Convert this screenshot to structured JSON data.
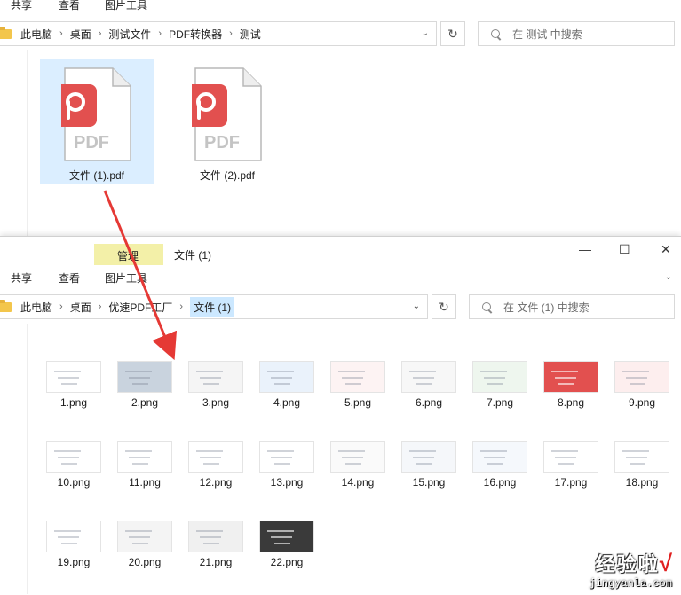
{
  "back_window": {
    "tabs": [
      "共享",
      "查看",
      "图片工具"
    ],
    "breadcrumb": [
      "此电脑",
      "桌面",
      "测试文件",
      "PDF转换器",
      "测试"
    ],
    "search_placeholder": "在 测试 中搜索",
    "files": [
      {
        "name": "文件 (1).pdf",
        "icon": "pdf-icon"
      },
      {
        "name": "文件 (2).pdf",
        "icon": "pdf-icon"
      }
    ]
  },
  "front_window": {
    "title": "文件 (1)",
    "context_tab": "管理",
    "tabs": [
      "共享",
      "查看",
      "图片工具"
    ],
    "breadcrumb": [
      "此电脑",
      "桌面",
      "优速PDF工厂",
      "文件 (1)"
    ],
    "search_placeholder": "在 文件 (1) 中搜索",
    "controls": {
      "minimize": "—",
      "maximize": "☐",
      "close": "✕"
    },
    "files": [
      {
        "name": "1.png"
      },
      {
        "name": "2.png"
      },
      {
        "name": "3.png"
      },
      {
        "name": "4.png"
      },
      {
        "name": "5.png"
      },
      {
        "name": "6.png"
      },
      {
        "name": "7.png"
      },
      {
        "name": "8.png"
      },
      {
        "name": "9.png"
      },
      {
        "name": "10.png"
      },
      {
        "name": "11.png"
      },
      {
        "name": "12.png"
      },
      {
        "name": "13.png"
      },
      {
        "name": "14.png"
      },
      {
        "name": "15.png"
      },
      {
        "name": "16.png"
      },
      {
        "name": "17.png"
      },
      {
        "name": "18.png"
      },
      {
        "name": "19.png"
      },
      {
        "name": "20.png"
      },
      {
        "name": "21.png"
      },
      {
        "name": "22.png"
      }
    ]
  },
  "watermark": {
    "text": "经验啦",
    "check": "√",
    "url": "jingyanla.com"
  },
  "colors": {
    "pdf_red": "#e2504f",
    "selection": "#dbeeff",
    "manage_tab": "#f3f0a8",
    "arrow": "#e53935"
  }
}
